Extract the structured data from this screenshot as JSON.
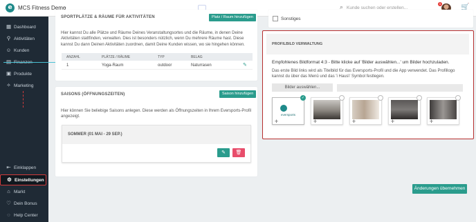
{
  "app": {
    "name": "MCS Fitness Demo"
  },
  "search": {
    "placeholder": "Kunde suchen oder erstellen..."
  },
  "notifications": {
    "count": "1"
  },
  "colors": {
    "accent": "#2a9c8d",
    "highlight": "#b72f2f",
    "sidebar": "#1f2a35",
    "danger": "#e84d6b"
  },
  "sidebar": {
    "items": [
      {
        "label": "Dashboard",
        "icon": "dashboard-icon"
      },
      {
        "label": "Aktivitäten",
        "icon": "activity-icon"
      },
      {
        "label": "Kunden",
        "icon": "customers-icon"
      },
      {
        "label": "Finanzen",
        "icon": "finance-icon"
      },
      {
        "label": "Produkte",
        "icon": "products-icon"
      },
      {
        "label": "Marketing",
        "icon": "marketing-icon"
      }
    ],
    "bottom": [
      {
        "label": "Einklappen",
        "icon": "collapse-icon"
      },
      {
        "label": "Einstellungen",
        "icon": "gear-icon",
        "active": true
      },
      {
        "label": "Markt",
        "icon": "market-icon"
      },
      {
        "label": "Dein Bonus",
        "icon": "heart-icon"
      },
      {
        "label": "Help Center",
        "icon": "help-icon"
      }
    ]
  },
  "places": {
    "title": "SPORTPLÄTZE & RÄUME FÜR AKTIVITÄTEN",
    "add_label": "Platz / Raum hinzufügen",
    "description": "Hier kannst Du alle Plätze und Räume Deines Veranstaltungsortes und die Räume, in denen Deine Aktivitäten stattfinden, verwalten. Dies ist besonders nützlich, wenn Du mehrere Räume hast. Diese kannst Du dann Deinen Aktivitäten zuordnen, damit Deine Kunden wissen, wo sie hingehen können.",
    "columns": [
      "ANZAHL",
      "PLÄTZE / RÄUME",
      "TYP",
      "BELAG"
    ],
    "rows": [
      [
        "1",
        "Yoga-Raum",
        "outdoor",
        "Naturrasen"
      ]
    ]
  },
  "seasons": {
    "title": "SAISONS (ÖFFNUNGSZEITEN)",
    "add_label": "Saison hinzufügen",
    "description": "Hier können Sie beliebige Saisons anlegen. Diese werden als Öffnungszeiten in Ihrem Eversports-Profil angezeigt.",
    "items": [
      {
        "name": "SOMMER (01 MAI - 29 SEP.)"
      }
    ]
  },
  "misc": {
    "checkbox_label": "Sonstiges"
  },
  "profile": {
    "title": "PROFILBILD VERWALTUNG",
    "line1": "Empfohlenes Bildformat 4:3 - Bitte klicke auf 'Bilder auswählen...' um Bilder hochzuladen.",
    "line2": "Das erste Bild links wird als Titelbild für das Eversports-Profil und die App verwendet. Das Profillogo kannst du über das Menü und das 'i Haus\\' Symbol festlegen.",
    "upload_label": "Bilder auswählen...",
    "logo_text": "eversports",
    "thumbs": [
      "eversports-logo",
      "gym-photo-1",
      "gym-photo-2",
      "gym-photo-3",
      "gym-photo-4"
    ]
  },
  "save_label": "Änderungen übernehmen"
}
